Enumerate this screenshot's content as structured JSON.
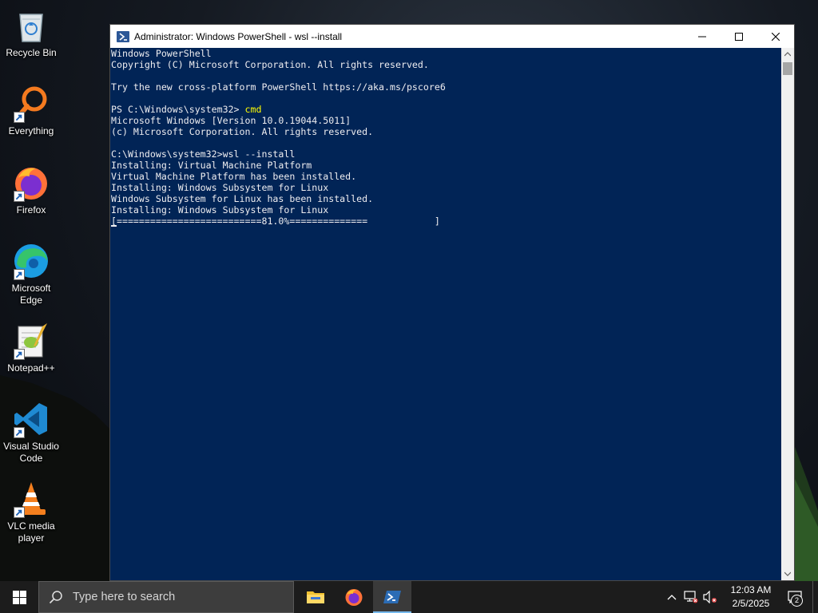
{
  "desktop": {
    "icons": [
      {
        "label": "Recycle Bin",
        "icon": "recycle-bin-icon"
      },
      {
        "label": "Everything",
        "icon": "everything-search-icon"
      },
      {
        "label": "Firefox",
        "icon": "firefox-icon"
      },
      {
        "label": "Microsoft Edge",
        "icon": "edge-icon"
      },
      {
        "label": "Notepad++",
        "icon": "notepadpp-icon"
      },
      {
        "label": "Visual Studio Code",
        "icon": "vscode-icon"
      },
      {
        "label": "VLC media player",
        "icon": "vlc-icon"
      }
    ]
  },
  "window": {
    "title": "Administrator: Windows PowerShell - wsl  --install",
    "console_lines": [
      {
        "text": "Windows PowerShell"
      },
      {
        "text": "Copyright (C) Microsoft Corporation. All rights reserved."
      },
      {
        "text": ""
      },
      {
        "text": "Try the new cross-platform PowerShell https://aka.ms/pscore6"
      },
      {
        "text": ""
      },
      {
        "prompt": "PS C:\\Windows\\system32> ",
        "command": "cmd"
      },
      {
        "text": "Microsoft Windows [Version 10.0.19044.5011]"
      },
      {
        "text": "(c) Microsoft Corporation. All rights reserved."
      },
      {
        "text": ""
      },
      {
        "text": "C:\\Windows\\system32>wsl --install"
      },
      {
        "text": "Installing: Virtual Machine Platform"
      },
      {
        "text": "Virtual Machine Platform has been installed."
      },
      {
        "text": "Installing: Windows Subsystem for Linux"
      },
      {
        "text": "Windows Subsystem for Linux has been installed."
      },
      {
        "text": "Installing: Windows Subsystem for Linux"
      },
      {
        "text": "[==========================81.0%==============            ]"
      }
    ],
    "background_color": "#012456",
    "text_color": "#eeedf0",
    "command_color": "#ffff00"
  },
  "taskbar": {
    "search_placeholder": "Type here to search",
    "apps": [
      {
        "name": "file-explorer-icon"
      },
      {
        "name": "firefox-icon"
      },
      {
        "name": "powershell-icon"
      }
    ],
    "clock": {
      "time": "12:03 AM",
      "date": "2/5/2025"
    },
    "notification_count": "2"
  }
}
